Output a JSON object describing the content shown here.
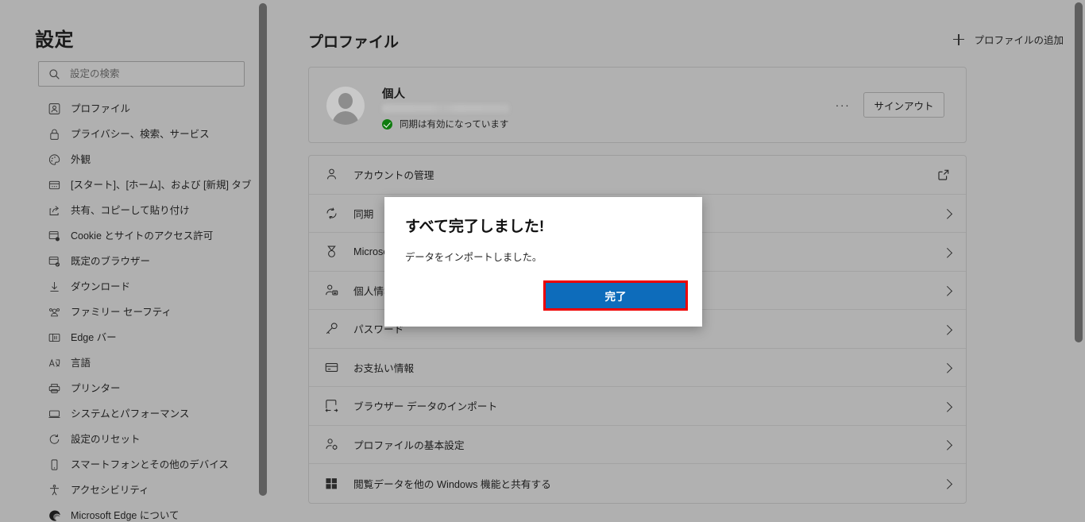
{
  "sidebar": {
    "title": "設定",
    "search": {
      "placeholder": "設定の検索",
      "value": "",
      "icon": "search-icon"
    },
    "items": [
      {
        "label": "プロファイル",
        "icon": "profile-icon"
      },
      {
        "label": "プライバシー、検索、サービス",
        "icon": "lock-icon"
      },
      {
        "label": "外観",
        "icon": "palette-icon"
      },
      {
        "label": "[スタート]、[ホーム]、および [新規] タブ",
        "icon": "start-tab-icon"
      },
      {
        "label": "共有、コピーして貼り付け",
        "icon": "share-icon"
      },
      {
        "label": "Cookie とサイトのアクセス許可",
        "icon": "cookie-permissions-icon"
      },
      {
        "label": "既定のブラウザー",
        "icon": "default-browser-icon"
      },
      {
        "label": "ダウンロード",
        "icon": "download-icon"
      },
      {
        "label": "ファミリー セーフティ",
        "icon": "family-safety-icon"
      },
      {
        "label": "Edge バー",
        "icon": "edge-bar-icon"
      },
      {
        "label": "言語",
        "icon": "language-icon"
      },
      {
        "label": "プリンター",
        "icon": "printer-icon"
      },
      {
        "label": "システムとパフォーマンス",
        "icon": "system-performance-icon"
      },
      {
        "label": "設定のリセット",
        "icon": "reset-icon"
      },
      {
        "label": "スマートフォンとその他のデバイス",
        "icon": "phone-icon"
      },
      {
        "label": "アクセシビリティ",
        "icon": "accessibility-icon"
      },
      {
        "label": "Microsoft Edge について",
        "icon": "edge-logo-icon"
      }
    ]
  },
  "main": {
    "page_title": "プロファイル",
    "add_profile_label": "プロファイルの追加",
    "profile_card": {
      "name": "個人",
      "email_masked": "",
      "sync_status": "同期は有効になっています",
      "more_label": "···",
      "signout_label": "サインアウト"
    },
    "settings_rows": [
      {
        "label": "アカウントの管理",
        "icon": "person-icon",
        "affordance": "external-link"
      },
      {
        "label": "同期",
        "icon": "sync-icon",
        "affordance": "chevron"
      },
      {
        "label": "Microsoft Rewards",
        "icon": "rewards-icon",
        "affordance": "chevron"
      },
      {
        "label": "個人情報",
        "icon": "personal-info-icon",
        "affordance": "chevron"
      },
      {
        "label": "パスワード",
        "icon": "key-icon",
        "affordance": "chevron"
      },
      {
        "label": "お支払い情報",
        "icon": "card-icon",
        "affordance": "chevron"
      },
      {
        "label": "ブラウザー データのインポート",
        "icon": "import-icon",
        "affordance": "chevron"
      },
      {
        "label": "プロファイルの基本設定",
        "icon": "profile-prefs-icon",
        "affordance": "chevron"
      },
      {
        "label": "閲覧データを他の Windows 機能と共有する",
        "icon": "windows-icon",
        "affordance": "chevron"
      }
    ]
  },
  "dialog": {
    "title": "すべて完了しました!",
    "body": "データをインポートしました。",
    "confirm_label": "完了",
    "highlight_color": "#ee0000",
    "accent_color": "#0d6cbb"
  }
}
